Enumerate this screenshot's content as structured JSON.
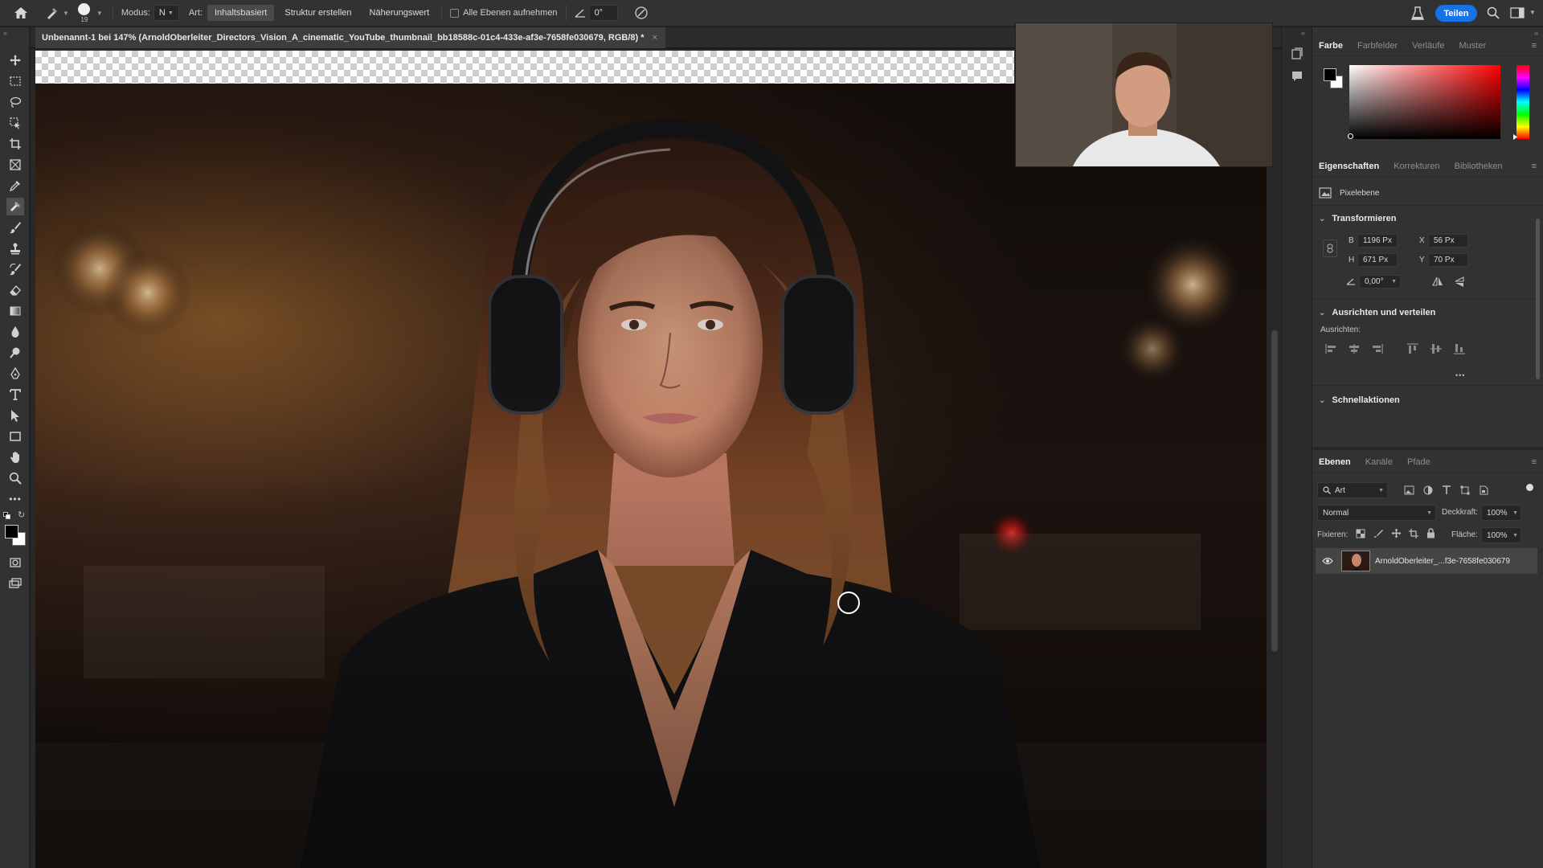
{
  "options_bar": {
    "brush_size": "19",
    "mode_label": "Modus:",
    "mode_value": "N",
    "type_label": "Art:",
    "type_buttons": [
      "Inhaltsbasiert",
      "Struktur erstellen",
      "Näherungswert"
    ],
    "sample_all_layers": "Alle Ebenen aufnehmen",
    "angle": "0°",
    "share_button": "Teilen"
  },
  "document": {
    "tab_title": "Unbenannt-1 bei 147% (ArnoldOberleiter_Directors_Vision_A_cinematic_YouTube_thumbnail_bb18588c-01c4-433e-af3e-7658fe030679, RGB/8) *",
    "close_glyph": "×"
  },
  "color_panel": {
    "tabs": [
      "Farbe",
      "Farbfelder",
      "Verläufe",
      "Muster"
    ],
    "active_tab": "Farbe",
    "foreground": "#000000",
    "background": "#ffffff",
    "hue_color": "#ff0000"
  },
  "properties_panel": {
    "tabs": [
      "Eigenschaften",
      "Korrekturen",
      "Bibliotheken"
    ],
    "active_tab": "Eigenschaften",
    "layer_type": "Pixelebene",
    "transform_header": "Transformieren",
    "width_label": "B",
    "width_value": "1196 Px",
    "height_label": "H",
    "height_value": "671 Px",
    "x_label": "X",
    "x_value": "56 Px",
    "y_label": "Y",
    "y_value": "70 Px",
    "angle_value": "0,00°",
    "align_header": "Ausrichten und verteilen",
    "align_label": "Ausrichten:",
    "more_glyph": "•••",
    "quick_actions_header": "Schnellaktionen"
  },
  "layers_panel": {
    "tabs": [
      "Ebenen",
      "Kanäle",
      "Pfade"
    ],
    "active_tab": "Ebenen",
    "filter_label": "Art",
    "blend_mode": "Normal",
    "opacity_label": "Deckkraft:",
    "opacity_value": "100%",
    "lock_label": "Fixieren:",
    "fill_label": "Fläche:",
    "fill_value": "100%",
    "layers": [
      {
        "name": "ArnoldOberleiter_...f3e-7658fe030679",
        "visible": true
      }
    ]
  }
}
